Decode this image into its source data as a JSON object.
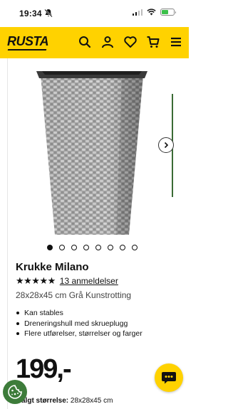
{
  "status_bar": {
    "time": "19:34"
  },
  "header": {
    "logo": "RUSTA"
  },
  "product": {
    "title": "Krukke Milano",
    "stars": "★★★★★",
    "reviews_link": "13 anmeldelser",
    "subtitle": "28x28x45 cm Grå Kunstrotting",
    "features": [
      "Kan stables",
      "Dreneringshull med skrueplugg",
      "Flere utførelser, størrelser og farger"
    ],
    "price": "199,-",
    "selected_size_label": "algt størrelse:",
    "selected_size_value": "28x28x45 cm",
    "image_count": 8,
    "active_image": 1
  },
  "colors": {
    "brand_yellow": "#ffd200",
    "cookie_green": "#3d7c3a",
    "text": "#111111"
  },
  "icons": [
    "bell-off-icon",
    "signal-icon",
    "wifi-icon",
    "battery-icon",
    "search-icon",
    "user-icon",
    "heart-icon",
    "cart-icon",
    "menu-icon",
    "chevron-right-icon",
    "chat-icon",
    "cookie-icon"
  ]
}
